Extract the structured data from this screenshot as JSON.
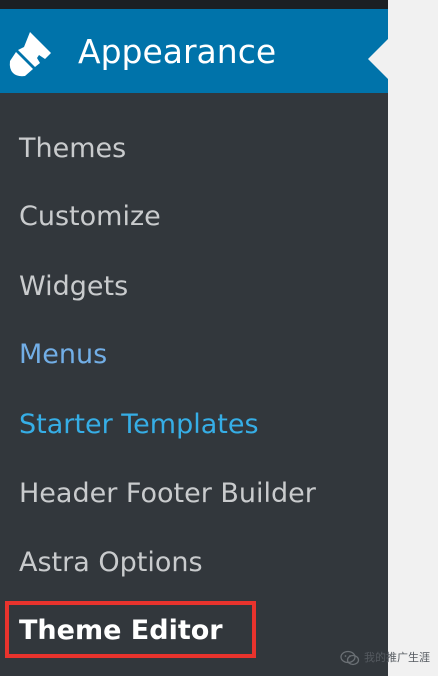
{
  "menu": {
    "title": "Appearance",
    "icon": "paintbrush-icon",
    "active_color": "#0073aa",
    "items": [
      {
        "label": "Themes"
      },
      {
        "label": "Customize"
      },
      {
        "label": "Widgets"
      },
      {
        "label": "Menus"
      },
      {
        "label": "Starter Templates"
      },
      {
        "label": "Header Footer Builder"
      },
      {
        "label": "Astra Options"
      },
      {
        "label": "Theme Editor",
        "current": true,
        "highlighted": true
      }
    ]
  },
  "annotation": {
    "highlight_color": "#e8332d"
  },
  "watermark": {
    "text": "我的推广生涯",
    "icon": "wechat-icon"
  }
}
